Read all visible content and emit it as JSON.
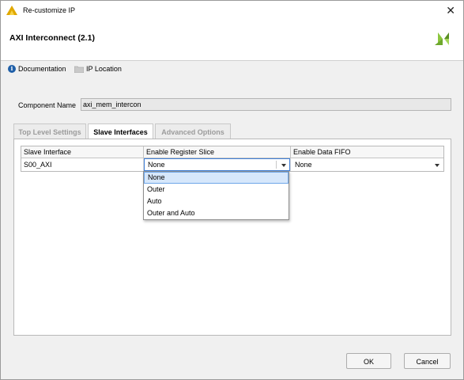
{
  "window": {
    "title": "Re-customize IP"
  },
  "header": {
    "ip_title": "AXI Interconnect (2.1)"
  },
  "links": {
    "documentation": "Documentation",
    "ip_location": "IP Location"
  },
  "component": {
    "label": "Component Name",
    "value": "axi_mem_intercon"
  },
  "tabs": [
    {
      "label": "Top Level Settings",
      "active": false
    },
    {
      "label": "Slave Interfaces",
      "active": true
    },
    {
      "label": "Advanced Options",
      "active": false
    }
  ],
  "table": {
    "columns": [
      "Slave Interface",
      "Enable Register Slice",
      "Enable Data FIFO"
    ],
    "rows": [
      {
        "interface": "S00_AXI",
        "register_slice": "None",
        "data_fifo": "None"
      }
    ]
  },
  "dropdown": {
    "options": [
      "None",
      "Outer",
      "Auto",
      "Outer and Auto"
    ],
    "selected": "None"
  },
  "buttons": {
    "ok": "OK",
    "cancel": "Cancel"
  },
  "colors": {
    "accent_blue": "#3f7fd8",
    "selection": "#d6e7fb",
    "logo_green": "#8cc63e"
  }
}
